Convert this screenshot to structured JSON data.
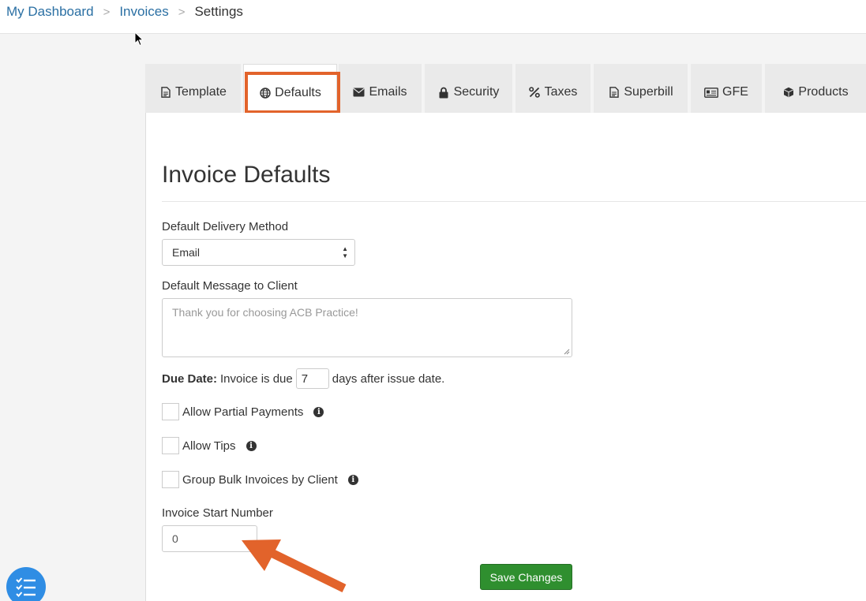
{
  "breadcrumb": {
    "items": [
      {
        "label": "My Dashboard"
      },
      {
        "label": "Invoices"
      }
    ],
    "separator": ">",
    "current": "Settings"
  },
  "tabs": [
    {
      "label": "Template",
      "icon": "file-icon"
    },
    {
      "label": "Defaults",
      "icon": "globe-icon"
    },
    {
      "label": "Emails",
      "icon": "envelope-icon"
    },
    {
      "label": "Security",
      "icon": "lock-icon"
    },
    {
      "label": "Taxes",
      "icon": "percent-icon"
    },
    {
      "label": "Superbill",
      "icon": "file-icon"
    },
    {
      "label": "GFE",
      "icon": "id-card-icon"
    },
    {
      "label": "Products",
      "icon": "cube-icon"
    }
  ],
  "active_tab": "Defaults",
  "form": {
    "title": "Invoice Defaults",
    "delivery_label": "Default Delivery Method",
    "delivery_value": "Email",
    "message_label": "Default Message to Client",
    "message_placeholder": "Thank you for choosing ACB Practice!",
    "due_date_label": "Due Date:",
    "due_date_prefix": "Invoice is due",
    "due_date_value": "7",
    "due_date_suffix": "days after issue date.",
    "checkboxes": [
      {
        "label": "Allow Partial Payments",
        "checked": false
      },
      {
        "label": "Allow Tips",
        "checked": false
      },
      {
        "label": "Group Bulk Invoices by Client",
        "checked": false
      }
    ],
    "start_number_label": "Invoice Start Number",
    "start_number_value": "0",
    "save_label": "Save Changes"
  },
  "colors": {
    "link": "#2a6fa3",
    "highlight": "#e2632b",
    "save_button": "#2f8f2f",
    "fab": "#2f8de4"
  }
}
